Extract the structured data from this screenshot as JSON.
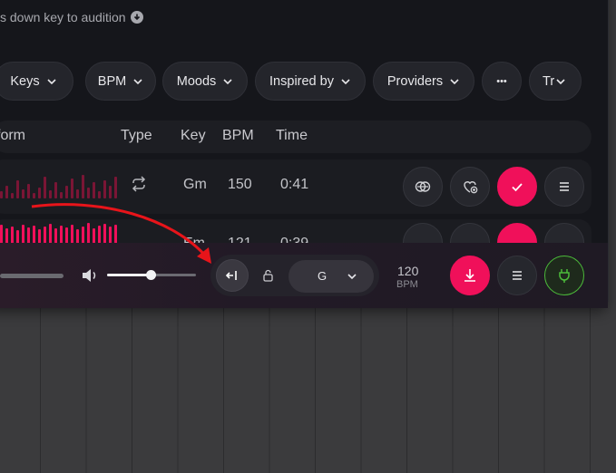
{
  "hint_text": "s down key to audition",
  "filters": [
    {
      "label": "Keys"
    },
    {
      "label": "BPM"
    },
    {
      "label": "Moods"
    },
    {
      "label": "Inspired by"
    },
    {
      "label": "Providers"
    },
    {
      "label": "Tr"
    }
  ],
  "more_label": "•••",
  "columns": {
    "waveform": "form",
    "type": "Type",
    "key": "Key",
    "bpm": "BPM",
    "time": "Time"
  },
  "rows": [
    {
      "key": "Gm",
      "bpm": "150",
      "time": "0:41"
    },
    {
      "key": "Em",
      "bpm": "121",
      "time": "0:39"
    }
  ],
  "transport": {
    "key_value": "G",
    "bpm_value": "120",
    "bpm_label": "BPM",
    "volume_level": 0.5
  },
  "colors": {
    "accent": "#f0105a",
    "active_green": "#4cbb3a"
  }
}
